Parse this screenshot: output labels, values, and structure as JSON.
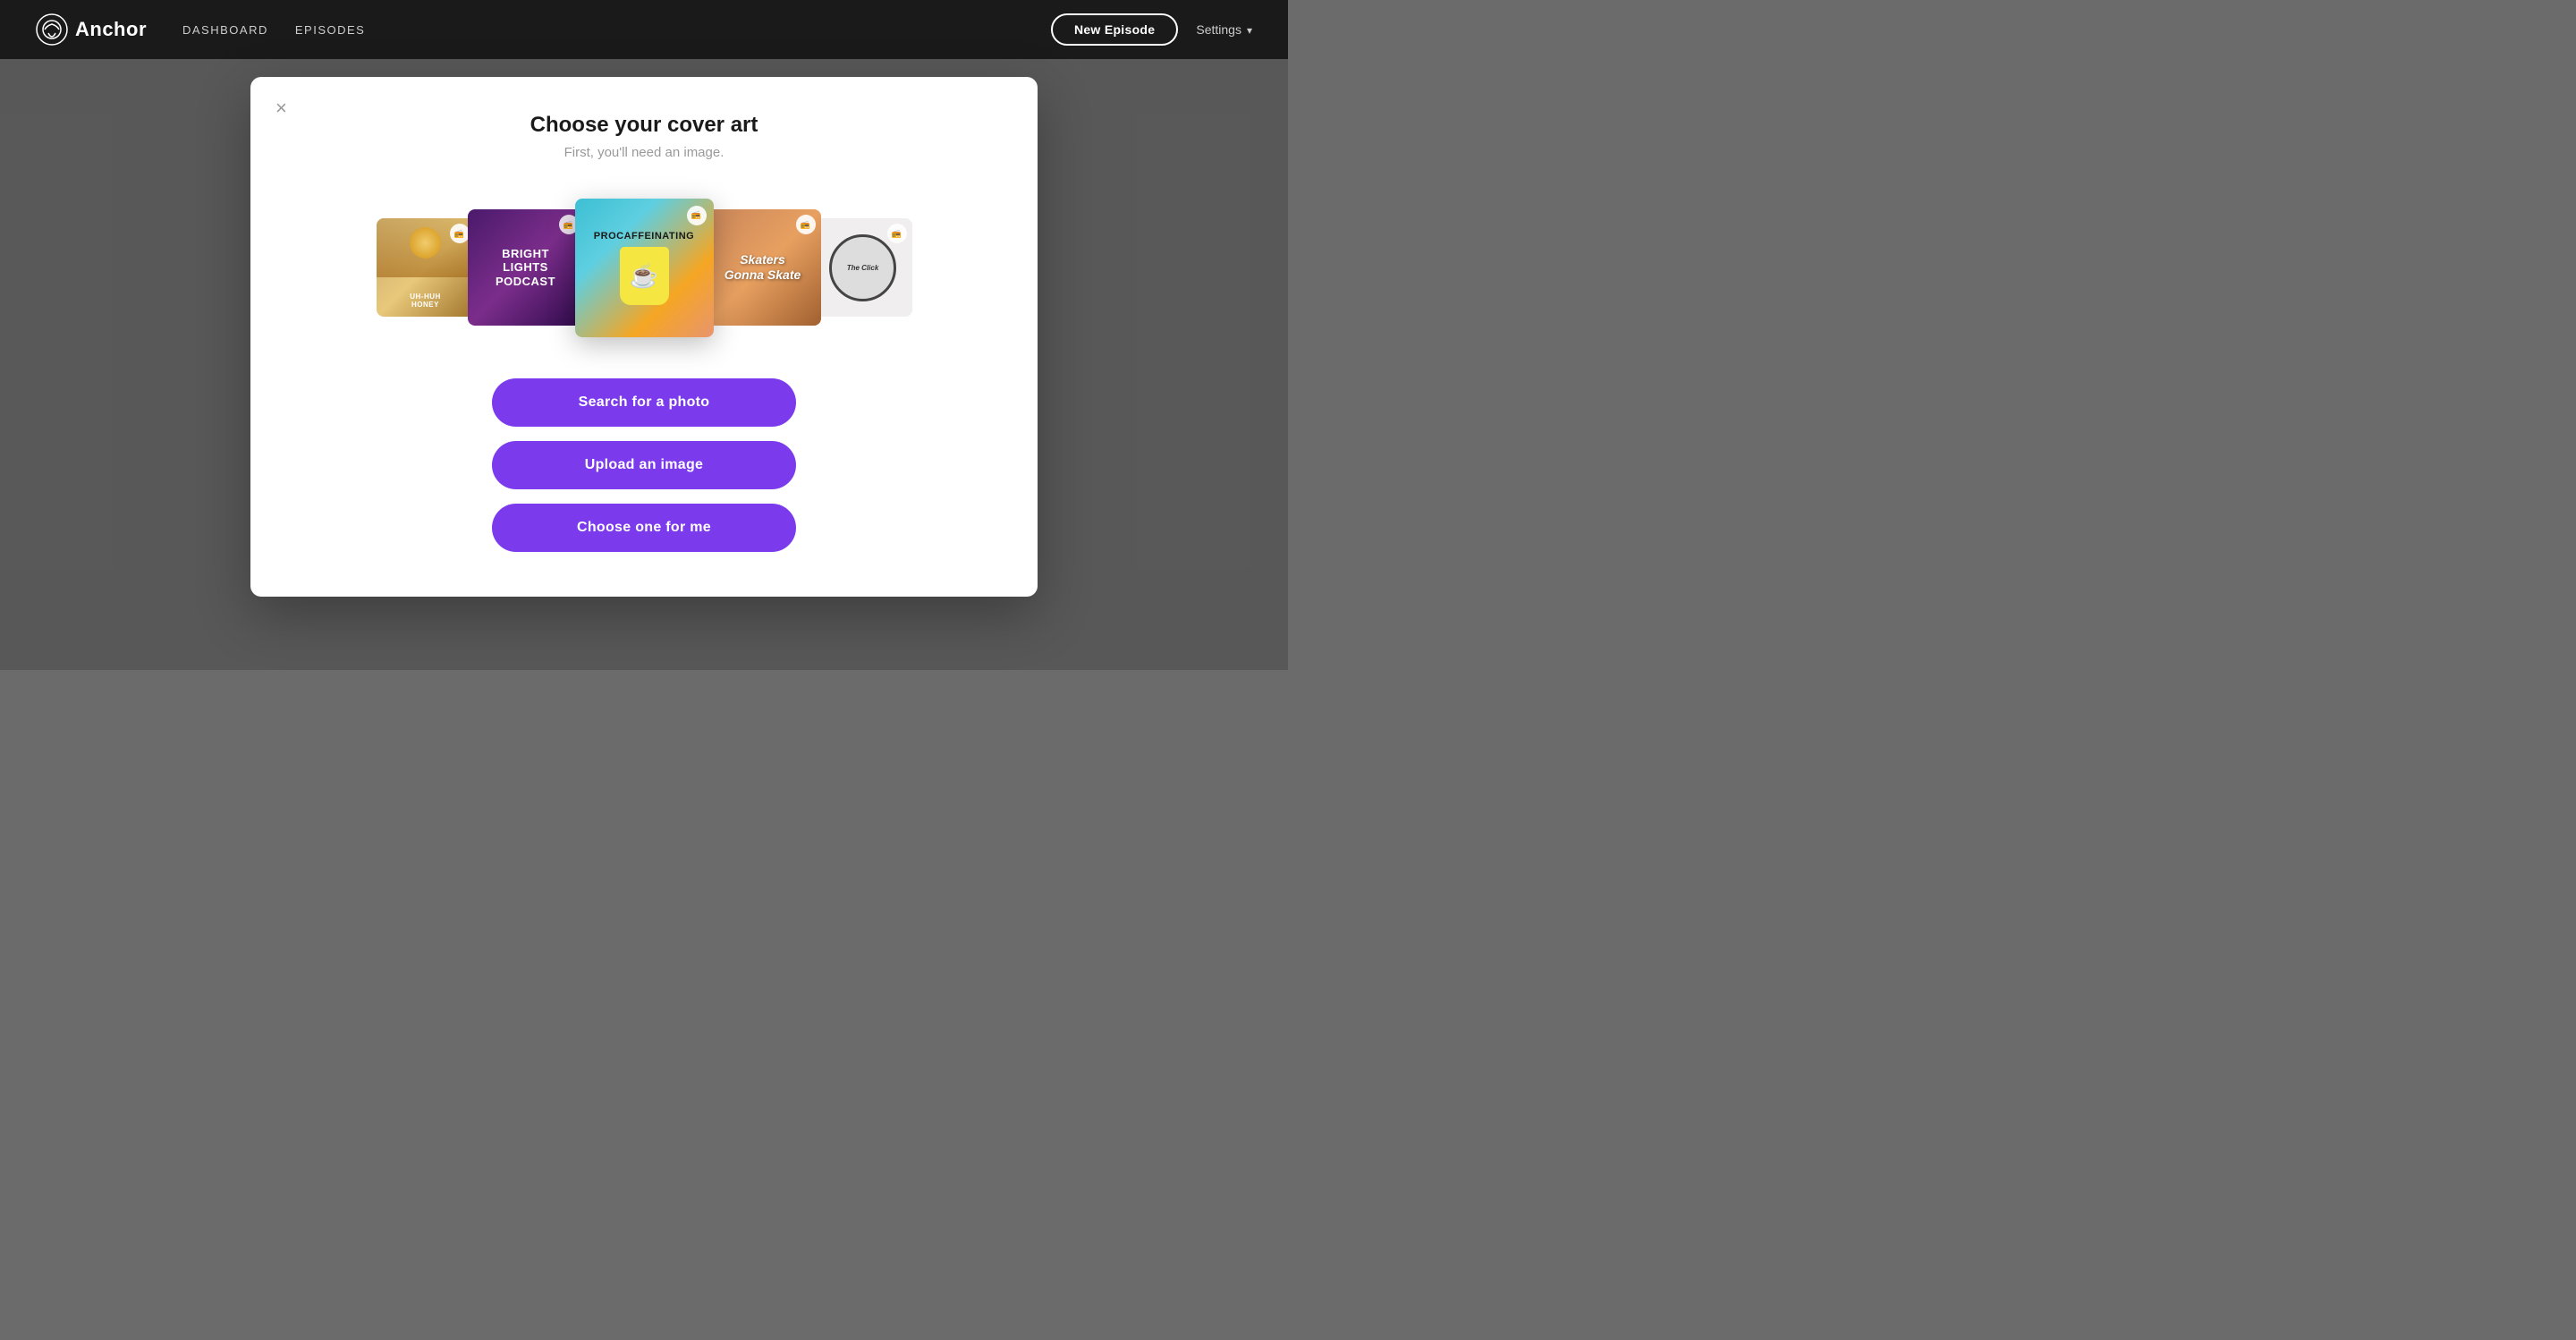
{
  "navbar": {
    "logo_text": "Anchor",
    "nav_items": [
      {
        "label": "DASHBOARD",
        "id": "dashboard"
      },
      {
        "label": "EPISODES",
        "id": "episodes"
      }
    ],
    "new_episode_label": "New Episode",
    "settings_label": "Settings"
  },
  "modal": {
    "title": "Choose your cover art",
    "subtitle": "First, you'll need an image.",
    "close_icon": "×",
    "covers": [
      {
        "id": "honey",
        "label": "uh-huh HONEY",
        "size": "sm"
      },
      {
        "id": "bright",
        "label": "BRIGHT LIGHTS PODCAST",
        "size": "md"
      },
      {
        "id": "procaff",
        "label": "PROCAFFEINATING",
        "size": "lg"
      },
      {
        "id": "skaters",
        "label": "Skaters Gonna Skate",
        "size": "md"
      },
      {
        "id": "click",
        "label": "The Click",
        "size": "sm"
      }
    ],
    "buttons": [
      {
        "id": "search-photo",
        "label": "Search for a photo"
      },
      {
        "id": "upload-image",
        "label": "Upload an image"
      },
      {
        "id": "choose-me",
        "label": "Choose one for me"
      }
    ]
  }
}
